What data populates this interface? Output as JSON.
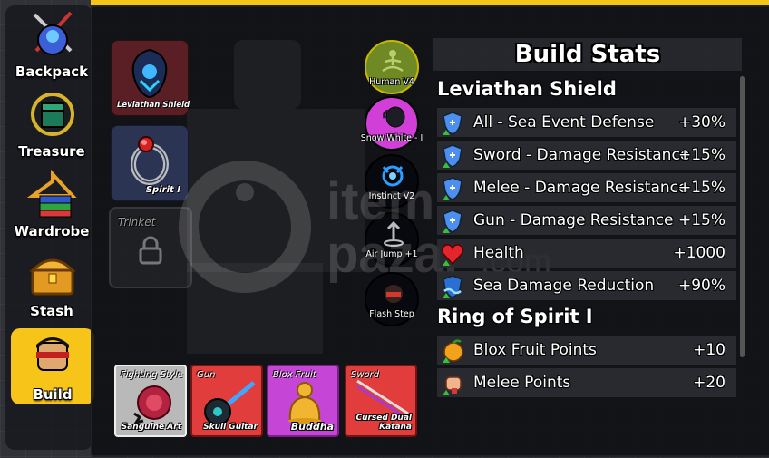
{
  "sidenav": {
    "items": [
      {
        "label": "Backpack",
        "icon": "backpack-icon"
      },
      {
        "label": "Treasure",
        "icon": "treasure-icon"
      },
      {
        "label": "Wardrobe",
        "icon": "wardrobe-icon"
      },
      {
        "label": "Stash",
        "icon": "stash-chest-icon"
      },
      {
        "label": "Build",
        "icon": "build-avatar-icon",
        "active": true
      }
    ]
  },
  "equipment": {
    "accessory_label": "Leviathan Shield",
    "ring_label": "Spirit I",
    "trinket_label": "Trinket"
  },
  "abilities": [
    {
      "label": "Human V4"
    },
    {
      "label": "Snow White - I"
    },
    {
      "label": "Instinct V2"
    },
    {
      "label": "Air Jump +1"
    },
    {
      "label": "Flash Step"
    }
  ],
  "loadout": [
    {
      "title": "Fighting Style",
      "name": "Sanguine Art",
      "color": "#b9b9b9"
    },
    {
      "title": "Gun",
      "name": "Skull Guitar",
      "color": "#e23d3d"
    },
    {
      "title": "Blox Fruit",
      "name": "Buddha",
      "color": "#c545d6"
    },
    {
      "title": "Sword",
      "name": "Cursed Dual Katana",
      "color": "#e23d3d"
    }
  ],
  "stats": {
    "title": "Build Stats",
    "sections": [
      {
        "heading": "Leviathan Shield",
        "rows": [
          {
            "name": "All - Sea Event Defense",
            "value": "+30%",
            "icon": "shield-icon"
          },
          {
            "name": "Sword - Damage Resistance",
            "value": "+15%",
            "icon": "shield-icon"
          },
          {
            "name": "Melee - Damage Resistance",
            "value": "+15%",
            "icon": "shield-icon"
          },
          {
            "name": "Gun - Damage Resistance",
            "value": "+15%",
            "icon": "shield-icon"
          },
          {
            "name": "Health",
            "value": "+1000",
            "icon": "heart-icon"
          },
          {
            "name": "Sea Damage Reduction",
            "value": "+90%",
            "icon": "sea-shield-icon"
          }
        ]
      },
      {
        "heading": "Ring of Spirit I",
        "rows": [
          {
            "name": "Blox Fruit Points",
            "value": "+10",
            "icon": "fruit-icon"
          },
          {
            "name": "Melee Points",
            "value": "+20",
            "icon": "fist-icon"
          }
        ]
      }
    ]
  },
  "watermark": {
    "line1": "item",
    "line2": "pazar",
    "suffix": ".com"
  }
}
